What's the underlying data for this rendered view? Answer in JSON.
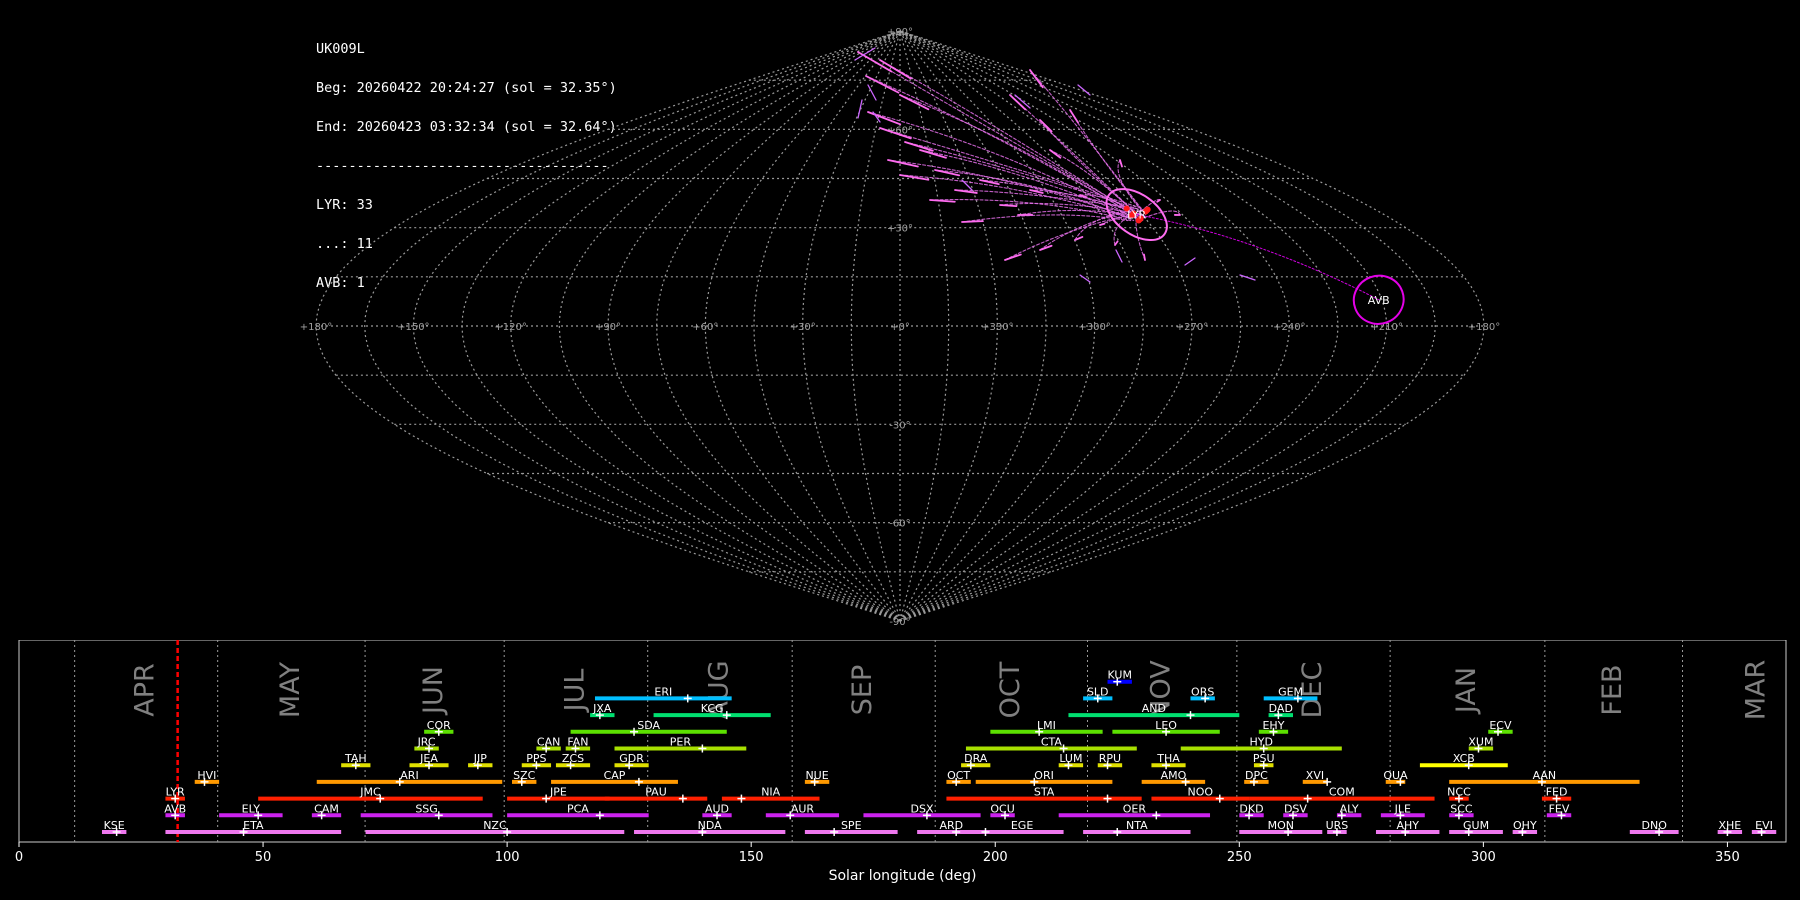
{
  "info": {
    "station": "UK009L",
    "beg": "Beg: 20260422 20:24:27 (sol = 32.35°)",
    "end": "End: 20260423 03:32:34 (sol = 32.64°)",
    "divider": "------------------------------------",
    "counts": [
      "LYR: 33",
      "...: 11",
      "AVB: 1"
    ]
  },
  "chart_data": [
    {
      "type": "scatter",
      "projection": "sinusoidal sky map",
      "grid": true,
      "lon_labels": [
        "+180°",
        "+150°",
        "+120°",
        "+90°",
        "+60°",
        "+30°",
        "+0°",
        "+330°",
        "+300°",
        "+270°",
        "+240°",
        "+210°",
        "+180°"
      ],
      "lat_labels": [
        "+90°",
        "+60°",
        "+30°",
        "-30°",
        "-60°",
        "-90°"
      ],
      "radiants": [
        {
          "name": "LYR",
          "lon": 272,
          "lat": 34,
          "count": 33,
          "color": "#ff6cf0"
        },
        {
          "name": "AVB",
          "lon": 211,
          "lat": 8,
          "count": 1,
          "color": "#e400e8"
        }
      ],
      "sporadic_count": 11
    },
    {
      "type": "timeline",
      "xlabel": "Solar longitude (deg)",
      "xlim": [
        0,
        362
      ],
      "xticks": [
        0,
        50,
        100,
        150,
        200,
        250,
        300,
        350
      ],
      "months": [
        {
          "label": "APR",
          "start": 11.4
        },
        {
          "label": "MAY",
          "start": 40.7
        },
        {
          "label": "JUN",
          "start": 70.9
        },
        {
          "label": "JUL",
          "start": 99.4
        },
        {
          "label": "AUG",
          "start": 128.8
        },
        {
          "label": "SEP",
          "start": 158.4
        },
        {
          "label": "OCT",
          "start": 187.7
        },
        {
          "label": "NOV",
          "start": 218.9
        },
        {
          "label": "DEC",
          "start": 249.5
        },
        {
          "label": "JAN",
          "start": 280.9
        },
        {
          "label": "FEB",
          "start": 312.6
        },
        {
          "label": "MAR",
          "start": 340.8
        }
      ],
      "current_sol": 32.5,
      "showers": [
        {
          "code": "KUM",
          "start": 223,
          "end": 228,
          "peak": 225,
          "row": 8,
          "color": "#0000ff"
        },
        {
          "code": "ERI",
          "start": 118,
          "end": 146,
          "peak": 137,
          "row": 7,
          "color": "#00bfff"
        },
        {
          "code": "SLD",
          "start": 218,
          "end": 224,
          "peak": 221,
          "row": 7,
          "color": "#00bfff"
        },
        {
          "code": "ORS",
          "start": 240,
          "end": 245,
          "peak": 243,
          "row": 7,
          "color": "#00bfff"
        },
        {
          "code": "GEM",
          "start": 255,
          "end": 266,
          "peak": 262,
          "row": 7,
          "color": "#00bfff"
        },
        {
          "code": "JXA",
          "start": 117,
          "end": 122,
          "peak": 119,
          "row": 6,
          "color": "#00e070"
        },
        {
          "code": "KCG",
          "start": 130,
          "end": 154,
          "peak": 145,
          "row": 6,
          "color": "#00e070"
        },
        {
          "code": "AND",
          "start": 215,
          "end": 250,
          "peak": 240,
          "row": 6,
          "color": "#00e070"
        },
        {
          "code": "DAD",
          "start": 256,
          "end": 261,
          "peak": 258,
          "row": 6,
          "color": "#00e070"
        },
        {
          "code": "COR",
          "start": 83,
          "end": 89,
          "peak": 86,
          "row": 5,
          "color": "#5ce000"
        },
        {
          "code": "SDA",
          "start": 113,
          "end": 145,
          "peak": 126,
          "row": 5,
          "color": "#5ce000"
        },
        {
          "code": "LMI",
          "start": 199,
          "end": 222,
          "peak": 209,
          "row": 5,
          "color": "#5ce000"
        },
        {
          "code": "LEO",
          "start": 224,
          "end": 246,
          "peak": 235,
          "row": 5,
          "color": "#5ce000"
        },
        {
          "code": "EHY",
          "start": 254,
          "end": 260,
          "peak": 257,
          "row": 5,
          "color": "#5ce000"
        },
        {
          "code": "ECV",
          "start": 301,
          "end": 306,
          "peak": 303,
          "row": 5,
          "color": "#5ce000"
        },
        {
          "code": "JRC",
          "start": 81,
          "end": 86,
          "peak": 84,
          "row": 4,
          "color": "#a8e000"
        },
        {
          "code": "CAN",
          "start": 106,
          "end": 111,
          "peak": 108,
          "row": 4,
          "color": "#a8e000"
        },
        {
          "code": "FAN",
          "start": 112,
          "end": 117,
          "peak": 114,
          "row": 4,
          "color": "#a8e000"
        },
        {
          "code": "PER",
          "start": 122,
          "end": 149,
          "peak": 140,
          "row": 4,
          "color": "#a8e000"
        },
        {
          "code": "CTA",
          "start": 194,
          "end": 229,
          "peak": 214,
          "row": 4,
          "color": "#a8e000"
        },
        {
          "code": "HYD",
          "start": 238,
          "end": 271,
          "peak": 255,
          "row": 4,
          "color": "#a8e000"
        },
        {
          "code": "XUM",
          "start": 297,
          "end": 302,
          "peak": 299,
          "row": 4,
          "color": "#a8e000"
        },
        {
          "code": "TAH",
          "start": 66,
          "end": 72,
          "peak": 69,
          "row": 3,
          "color": "#e0e000"
        },
        {
          "code": "JEA",
          "start": 80,
          "end": 88,
          "peak": 84,
          "row": 3,
          "color": "#e0e000"
        },
        {
          "code": "JIP",
          "start": 92,
          "end": 97,
          "peak": 94,
          "row": 3,
          "color": "#e0e000"
        },
        {
          "code": "PPS",
          "start": 103,
          "end": 109,
          "peak": 106,
          "row": 3,
          "color": "#e0e000"
        },
        {
          "code": "ZCS",
          "start": 110,
          "end": 117,
          "peak": 113,
          "row": 3,
          "color": "#e0e000"
        },
        {
          "code": "GDR",
          "start": 122,
          "end": 129,
          "peak": 125,
          "row": 3,
          "color": "#e0e000"
        },
        {
          "code": "DRA",
          "start": 193,
          "end": 199,
          "peak": 195,
          "row": 3,
          "color": "#e0e000"
        },
        {
          "code": "LUM",
          "start": 213,
          "end": 218,
          "peak": 215,
          "row": 3,
          "color": "#e0e000"
        },
        {
          "code": "RPU",
          "start": 221,
          "end": 226,
          "peak": 223,
          "row": 3,
          "color": "#e0e000"
        },
        {
          "code": "THA",
          "start": 232,
          "end": 239,
          "peak": 235,
          "row": 3,
          "color": "#e0e000"
        },
        {
          "code": "PSU",
          "start": 253,
          "end": 257,
          "peak": 255,
          "row": 3,
          "color": "#e0e000"
        },
        {
          "code": "XCB",
          "start": 287,
          "end": 305,
          "peak": 297,
          "row": 3,
          "color": "#ffff00"
        },
        {
          "code": "HVI",
          "start": 36,
          "end": 41,
          "peak": 38,
          "row": 2,
          "color": "#ff9900"
        },
        {
          "code": "ARI",
          "start": 61,
          "end": 99,
          "peak": 78,
          "row": 2,
          "color": "#ff9900"
        },
        {
          "code": "SZC",
          "start": 101,
          "end": 106,
          "peak": 103,
          "row": 2,
          "color": "#ff9900"
        },
        {
          "code": "CAP",
          "start": 109,
          "end": 135,
          "peak": 127,
          "row": 2,
          "color": "#ff9900"
        },
        {
          "code": "NUE",
          "start": 161,
          "end": 166,
          "peak": 163,
          "row": 2,
          "color": "#ff9900"
        },
        {
          "code": "OCT",
          "start": 190,
          "end": 195,
          "peak": 192,
          "row": 2,
          "color": "#ff9900"
        },
        {
          "code": "ORI",
          "start": 196,
          "end": 224,
          "peak": 208,
          "row": 2,
          "color": "#ff9900"
        },
        {
          "code": "AMO",
          "start": 230,
          "end": 243,
          "peak": 239,
          "row": 2,
          "color": "#ff9900"
        },
        {
          "code": "DPC",
          "start": 251,
          "end": 256,
          "peak": 253,
          "row": 2,
          "color": "#ff9900"
        },
        {
          "code": "XVI",
          "start": 263,
          "end": 268,
          "peak": 268,
          "row": 2,
          "color": "#ff9900"
        },
        {
          "code": "QUA",
          "start": 280,
          "end": 284,
          "peak": 283,
          "row": 2,
          "color": "#ff9900"
        },
        {
          "code": "AAN",
          "start": 293,
          "end": 332,
          "peak": 312,
          "row": 2,
          "color": "#ff9900"
        },
        {
          "code": "LYR",
          "start": 30,
          "end": 34,
          "peak": 32,
          "row": 1,
          "color": "#ff2000"
        },
        {
          "code": "JMC",
          "start": 49,
          "end": 95,
          "peak": 74,
          "row": 1,
          "color": "#ff2000"
        },
        {
          "code": "JPE",
          "start": 100,
          "end": 121,
          "peak": 108,
          "row": 1,
          "color": "#ff2000"
        },
        {
          "code": "PAU",
          "start": 120,
          "end": 141,
          "peak": 136,
          "row": 1,
          "color": "#ff2000"
        },
        {
          "code": "NIA",
          "start": 144,
          "end": 164,
          "peak": 148,
          "row": 1,
          "color": "#ff2000"
        },
        {
          "code": "STA",
          "start": 190,
          "end": 230,
          "peak": 223,
          "row": 1,
          "color": "#ff2000"
        },
        {
          "code": "NOO",
          "start": 232,
          "end": 252,
          "peak": 246,
          "row": 1,
          "color": "#ff2000"
        },
        {
          "code": "COM",
          "start": 252,
          "end": 290,
          "peak": 264,
          "row": 1,
          "color": "#ff2000"
        },
        {
          "code": "NCC",
          "start": 293,
          "end": 297,
          "peak": 295,
          "row": 1,
          "color": "#ff2000"
        },
        {
          "code": "FED",
          "start": 312,
          "end": 318,
          "peak": 315,
          "row": 1,
          "color": "#ff2000"
        },
        {
          "code": "AVB",
          "start": 30,
          "end": 34,
          "peak": 32,
          "row": 0,
          "color": "#cc22ee"
        },
        {
          "code": "ELY",
          "start": 41,
          "end": 54,
          "peak": 49,
          "row": 0,
          "color": "#cc22ee"
        },
        {
          "code": "CAM",
          "start": 60,
          "end": 66,
          "peak": 62,
          "row": 0,
          "color": "#cc22ee"
        },
        {
          "code": "SSG",
          "start": 70,
          "end": 97,
          "peak": 86,
          "row": 0,
          "color": "#cc22ee"
        },
        {
          "code": "PCA",
          "start": 100,
          "end": 129,
          "peak": 119,
          "row": 0,
          "color": "#cc22ee"
        },
        {
          "code": "AUD",
          "start": 140,
          "end": 146,
          "peak": 143,
          "row": 0,
          "color": "#cc22ee"
        },
        {
          "code": "AUR",
          "start": 153,
          "end": 168,
          "peak": 158,
          "row": 0,
          "color": "#cc22ee"
        },
        {
          "code": "DSX",
          "start": 173,
          "end": 197,
          "peak": 186,
          "row": 0,
          "color": "#cc22ee"
        },
        {
          "code": "OCU",
          "start": 199,
          "end": 204,
          "peak": 202,
          "row": 0,
          "color": "#cc22ee"
        },
        {
          "code": "OER",
          "start": 213,
          "end": 244,
          "peak": 233,
          "row": 0,
          "color": "#cc22ee"
        },
        {
          "code": "DKD",
          "start": 250,
          "end": 255,
          "peak": 252,
          "row": 0,
          "color": "#cc22ee"
        },
        {
          "code": "DSV",
          "start": 259,
          "end": 264,
          "peak": 261,
          "row": 0,
          "color": "#cc22ee"
        },
        {
          "code": "ALY",
          "start": 270,
          "end": 275,
          "peak": 271,
          "row": 0,
          "color": "#cc22ee"
        },
        {
          "code": "JLE",
          "start": 279,
          "end": 288,
          "peak": 283,
          "row": 0,
          "color": "#cc22ee"
        },
        {
          "code": "SCC",
          "start": 293,
          "end": 298,
          "peak": 295,
          "row": 0,
          "color": "#cc22ee"
        },
        {
          "code": "FEV",
          "start": 313,
          "end": 318,
          "peak": 316,
          "row": 0,
          "color": "#cc22ee"
        },
        {
          "code": "KSE",
          "start": 17,
          "end": 22,
          "peak": 20,
          "row": -1,
          "color": "#ee77ee"
        },
        {
          "code": "ETA",
          "start": 30,
          "end": 66,
          "peak": 46,
          "row": -1,
          "color": "#ee77ee"
        },
        {
          "code": "NZC",
          "start": 71,
          "end": 124,
          "peak": 100,
          "row": -1,
          "color": "#ee77ee"
        },
        {
          "code": "NDA",
          "start": 126,
          "end": 157,
          "peak": 140,
          "row": -1,
          "color": "#ee77ee"
        },
        {
          "code": "SPE",
          "start": 161,
          "end": 180,
          "peak": 167,
          "row": -1,
          "color": "#ee77ee"
        },
        {
          "code": "ARD",
          "start": 184,
          "end": 198,
          "peak": 192,
          "row": -1,
          "color": "#ee77ee"
        },
        {
          "code": "EGE",
          "start": 197,
          "end": 214,
          "peak": 198,
          "row": -1,
          "color": "#ee77ee"
        },
        {
          "code": "NTA",
          "start": 218,
          "end": 240,
          "peak": 225,
          "row": -1,
          "color": "#ee77ee"
        },
        {
          "code": "MON",
          "start": 250,
          "end": 267,
          "peak": 260,
          "row": -1,
          "color": "#ee77ee"
        },
        {
          "code": "URS",
          "start": 268,
          "end": 272,
          "peak": 270,
          "row": -1,
          "color": "#ee77ee"
        },
        {
          "code": "AHY",
          "start": 278,
          "end": 291,
          "peak": 284,
          "row": -1,
          "color": "#ee77ee"
        },
        {
          "code": "GUM",
          "start": 293,
          "end": 304,
          "peak": 297,
          "row": -1,
          "color": "#ee77ee"
        },
        {
          "code": "OHY",
          "start": 306,
          "end": 311,
          "peak": 308,
          "row": -1,
          "color": "#ee77ee"
        },
        {
          "code": "DNO",
          "start": 330,
          "end": 340,
          "peak": 336,
          "row": -1,
          "color": "#ee77ee"
        },
        {
          "code": "XHE",
          "start": 348,
          "end": 353,
          "peak": 350,
          "row": -1,
          "color": "#ee77ee"
        },
        {
          "code": "EVI",
          "start": 355,
          "end": 360,
          "peak": 357,
          "row": -1,
          "color": "#ee77ee"
        }
      ]
    }
  ]
}
